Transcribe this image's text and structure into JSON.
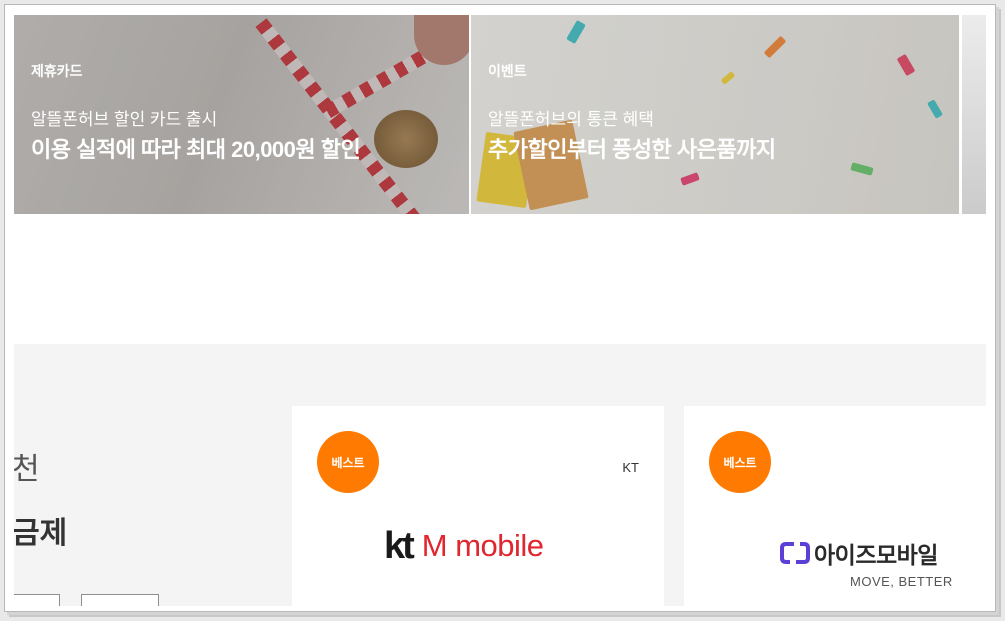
{
  "banners": [
    {
      "tag": "제휴카드",
      "subtitle": "알뜰폰허브 할인 카드 출시",
      "headline": "이용 실적에 따라 최대 20,000원 할인"
    },
    {
      "tag": "이벤트",
      "subtitle": "알뜰폰허브의 통큰 혜택",
      "headline": "추가할인부터 풍성한 사은품까지"
    }
  ],
  "recommend": {
    "title_partial": "천",
    "subtitle_partial": "금제"
  },
  "plans": [
    {
      "badge": "베스트",
      "carrier": "KT",
      "logo_mark": "kt",
      "logo_text": "M mobile"
    },
    {
      "badge": "베스트",
      "logo_text": "아이즈모바일",
      "logo_tagline": "MOVE, BETTER"
    }
  ],
  "colors": {
    "accent": "#ff7a00",
    "section_bg": "#f4f4f4",
    "ktm_red": "#e0262e",
    "iz_purple": "#5b3fd6"
  }
}
